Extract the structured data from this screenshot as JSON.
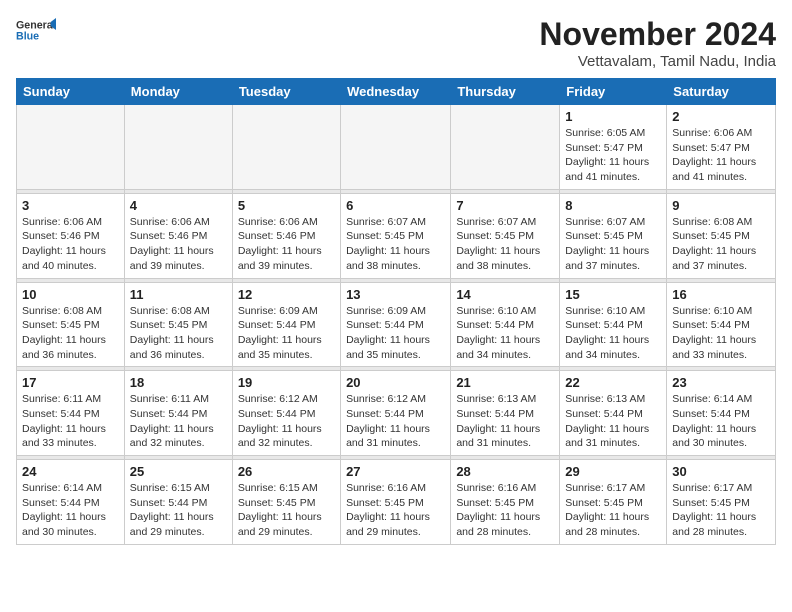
{
  "logo": {
    "general": "General",
    "blue": "Blue"
  },
  "header": {
    "month": "November 2024",
    "location": "Vettavalam, Tamil Nadu, India"
  },
  "weekdays": [
    "Sunday",
    "Monday",
    "Tuesday",
    "Wednesday",
    "Thursday",
    "Friday",
    "Saturday"
  ],
  "weeks": [
    [
      {
        "day": "",
        "info": ""
      },
      {
        "day": "",
        "info": ""
      },
      {
        "day": "",
        "info": ""
      },
      {
        "day": "",
        "info": ""
      },
      {
        "day": "",
        "info": ""
      },
      {
        "day": "1",
        "info": "Sunrise: 6:05 AM\nSunset: 5:47 PM\nDaylight: 11 hours and 41 minutes."
      },
      {
        "day": "2",
        "info": "Sunrise: 6:06 AM\nSunset: 5:47 PM\nDaylight: 11 hours and 41 minutes."
      }
    ],
    [
      {
        "day": "3",
        "info": "Sunrise: 6:06 AM\nSunset: 5:46 PM\nDaylight: 11 hours and 40 minutes."
      },
      {
        "day": "4",
        "info": "Sunrise: 6:06 AM\nSunset: 5:46 PM\nDaylight: 11 hours and 39 minutes."
      },
      {
        "day": "5",
        "info": "Sunrise: 6:06 AM\nSunset: 5:46 PM\nDaylight: 11 hours and 39 minutes."
      },
      {
        "day": "6",
        "info": "Sunrise: 6:07 AM\nSunset: 5:45 PM\nDaylight: 11 hours and 38 minutes."
      },
      {
        "day": "7",
        "info": "Sunrise: 6:07 AM\nSunset: 5:45 PM\nDaylight: 11 hours and 38 minutes."
      },
      {
        "day": "8",
        "info": "Sunrise: 6:07 AM\nSunset: 5:45 PM\nDaylight: 11 hours and 37 minutes."
      },
      {
        "day": "9",
        "info": "Sunrise: 6:08 AM\nSunset: 5:45 PM\nDaylight: 11 hours and 37 minutes."
      }
    ],
    [
      {
        "day": "10",
        "info": "Sunrise: 6:08 AM\nSunset: 5:45 PM\nDaylight: 11 hours and 36 minutes."
      },
      {
        "day": "11",
        "info": "Sunrise: 6:08 AM\nSunset: 5:45 PM\nDaylight: 11 hours and 36 minutes."
      },
      {
        "day": "12",
        "info": "Sunrise: 6:09 AM\nSunset: 5:44 PM\nDaylight: 11 hours and 35 minutes."
      },
      {
        "day": "13",
        "info": "Sunrise: 6:09 AM\nSunset: 5:44 PM\nDaylight: 11 hours and 35 minutes."
      },
      {
        "day": "14",
        "info": "Sunrise: 6:10 AM\nSunset: 5:44 PM\nDaylight: 11 hours and 34 minutes."
      },
      {
        "day": "15",
        "info": "Sunrise: 6:10 AM\nSunset: 5:44 PM\nDaylight: 11 hours and 34 minutes."
      },
      {
        "day": "16",
        "info": "Sunrise: 6:10 AM\nSunset: 5:44 PM\nDaylight: 11 hours and 33 minutes."
      }
    ],
    [
      {
        "day": "17",
        "info": "Sunrise: 6:11 AM\nSunset: 5:44 PM\nDaylight: 11 hours and 33 minutes."
      },
      {
        "day": "18",
        "info": "Sunrise: 6:11 AM\nSunset: 5:44 PM\nDaylight: 11 hours and 32 minutes."
      },
      {
        "day": "19",
        "info": "Sunrise: 6:12 AM\nSunset: 5:44 PM\nDaylight: 11 hours and 32 minutes."
      },
      {
        "day": "20",
        "info": "Sunrise: 6:12 AM\nSunset: 5:44 PM\nDaylight: 11 hours and 31 minutes."
      },
      {
        "day": "21",
        "info": "Sunrise: 6:13 AM\nSunset: 5:44 PM\nDaylight: 11 hours and 31 minutes."
      },
      {
        "day": "22",
        "info": "Sunrise: 6:13 AM\nSunset: 5:44 PM\nDaylight: 11 hours and 31 minutes."
      },
      {
        "day": "23",
        "info": "Sunrise: 6:14 AM\nSunset: 5:44 PM\nDaylight: 11 hours and 30 minutes."
      }
    ],
    [
      {
        "day": "24",
        "info": "Sunrise: 6:14 AM\nSunset: 5:44 PM\nDaylight: 11 hours and 30 minutes."
      },
      {
        "day": "25",
        "info": "Sunrise: 6:15 AM\nSunset: 5:44 PM\nDaylight: 11 hours and 29 minutes."
      },
      {
        "day": "26",
        "info": "Sunrise: 6:15 AM\nSunset: 5:45 PM\nDaylight: 11 hours and 29 minutes."
      },
      {
        "day": "27",
        "info": "Sunrise: 6:16 AM\nSunset: 5:45 PM\nDaylight: 11 hours and 29 minutes."
      },
      {
        "day": "28",
        "info": "Sunrise: 6:16 AM\nSunset: 5:45 PM\nDaylight: 11 hours and 28 minutes."
      },
      {
        "day": "29",
        "info": "Sunrise: 6:17 AM\nSunset: 5:45 PM\nDaylight: 11 hours and 28 minutes."
      },
      {
        "day": "30",
        "info": "Sunrise: 6:17 AM\nSunset: 5:45 PM\nDaylight: 11 hours and 28 minutes."
      }
    ]
  ]
}
